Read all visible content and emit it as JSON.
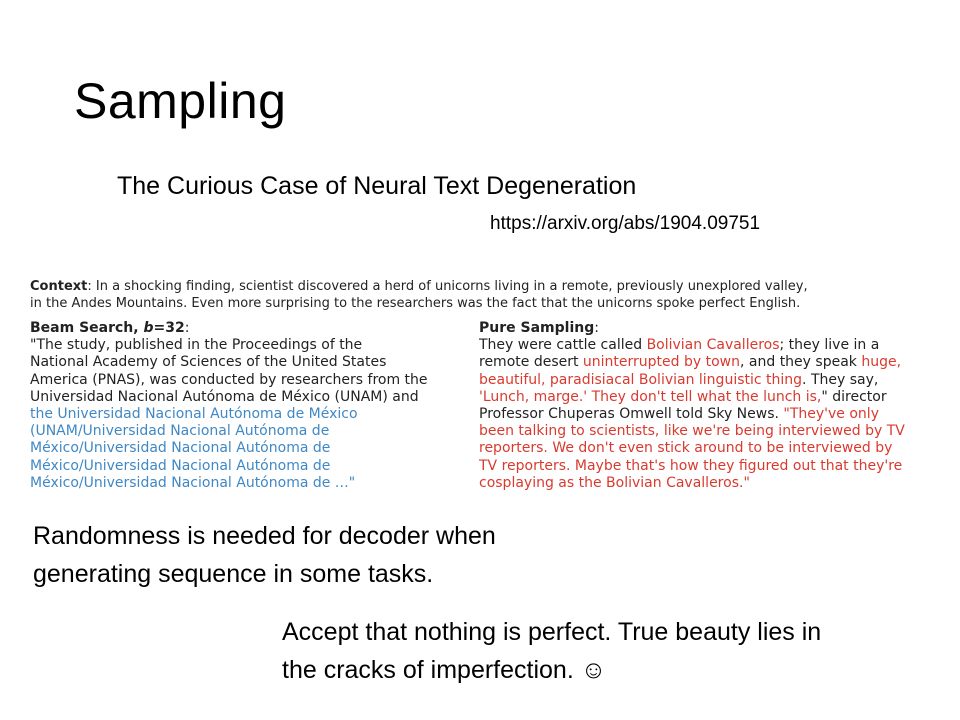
{
  "slide": {
    "title": "Sampling",
    "subtitle": "The Curious Case of Neural Text Degeneration",
    "link": "https://arxiv.org/abs/1904.09751"
  },
  "figure": {
    "context": {
      "label": "Context",
      "line1": ": In a shocking finding, scientist discovered a herd of unicorns living in a remote, previously unexplored valley,",
      "line2": "in the Andes Mountains. Even more surprising to the researchers was the fact that the unicorns spoke perfect English."
    },
    "beam_search": {
      "label_prefix": "Beam Search, ",
      "label_var": "b",
      "label_suffix": "=32",
      "label_colon": ":",
      "lines": [
        "\"The study, published in the Proceedings of the",
        "National Academy of Sciences of the United States",
        "America (PNAS), was conducted by researchers from the",
        "Universidad Nacional Autónoma de México (UNAM) and"
      ],
      "repeated_lines": [
        "the Universidad Nacional Autónoma de México",
        "(UNAM/Universidad Nacional Autónoma de",
        "México/Universidad Nacional Autónoma de",
        "México/Universidad Nacional Autónoma de",
        "México/Universidad Nacional Autónoma de …\""
      ]
    },
    "pure_sampling": {
      "label": "Pure Sampling",
      "label_colon": ":",
      "line1_a": "They were cattle called ",
      "line1_b": "Bolivian Cavalleros",
      "line1_c": "; they live in a",
      "line2_a": "remote desert ",
      "line2_b": "uninterrupted by town",
      "line2_c": ", and they speak ",
      "line2_d": "huge,",
      "line3_a": "beautiful, paradisiacal Bolivian linguistic thing",
      "line3_b": ". They say,",
      "line4_a": "'Lunch, marge.' They don't tell what the lunch is,",
      "line4_b": "\" director",
      "line5_a": "Professor Chuperas Omwell told Sky News. ",
      "line5_b": "\"They've only",
      "red_lines": [
        "been talking to scientists, like we're being interviewed by TV",
        "reporters. We don't even stick around to be interviewed by",
        "TV reporters. Maybe that's how they figured out that they're",
        "cosplaying as the Bolivian Cavalleros.\""
      ]
    }
  },
  "body": {
    "para1": [
      "Randomness is needed for decoder when",
      "generating sequence in some tasks."
    ],
    "para2": [
      "Accept that nothing is perfect. True beauty lies in",
      "the cracks of imperfection. ☺"
    ]
  },
  "colors": {
    "blue_text": "#3f88c5",
    "red_text": "#d93a2f"
  }
}
